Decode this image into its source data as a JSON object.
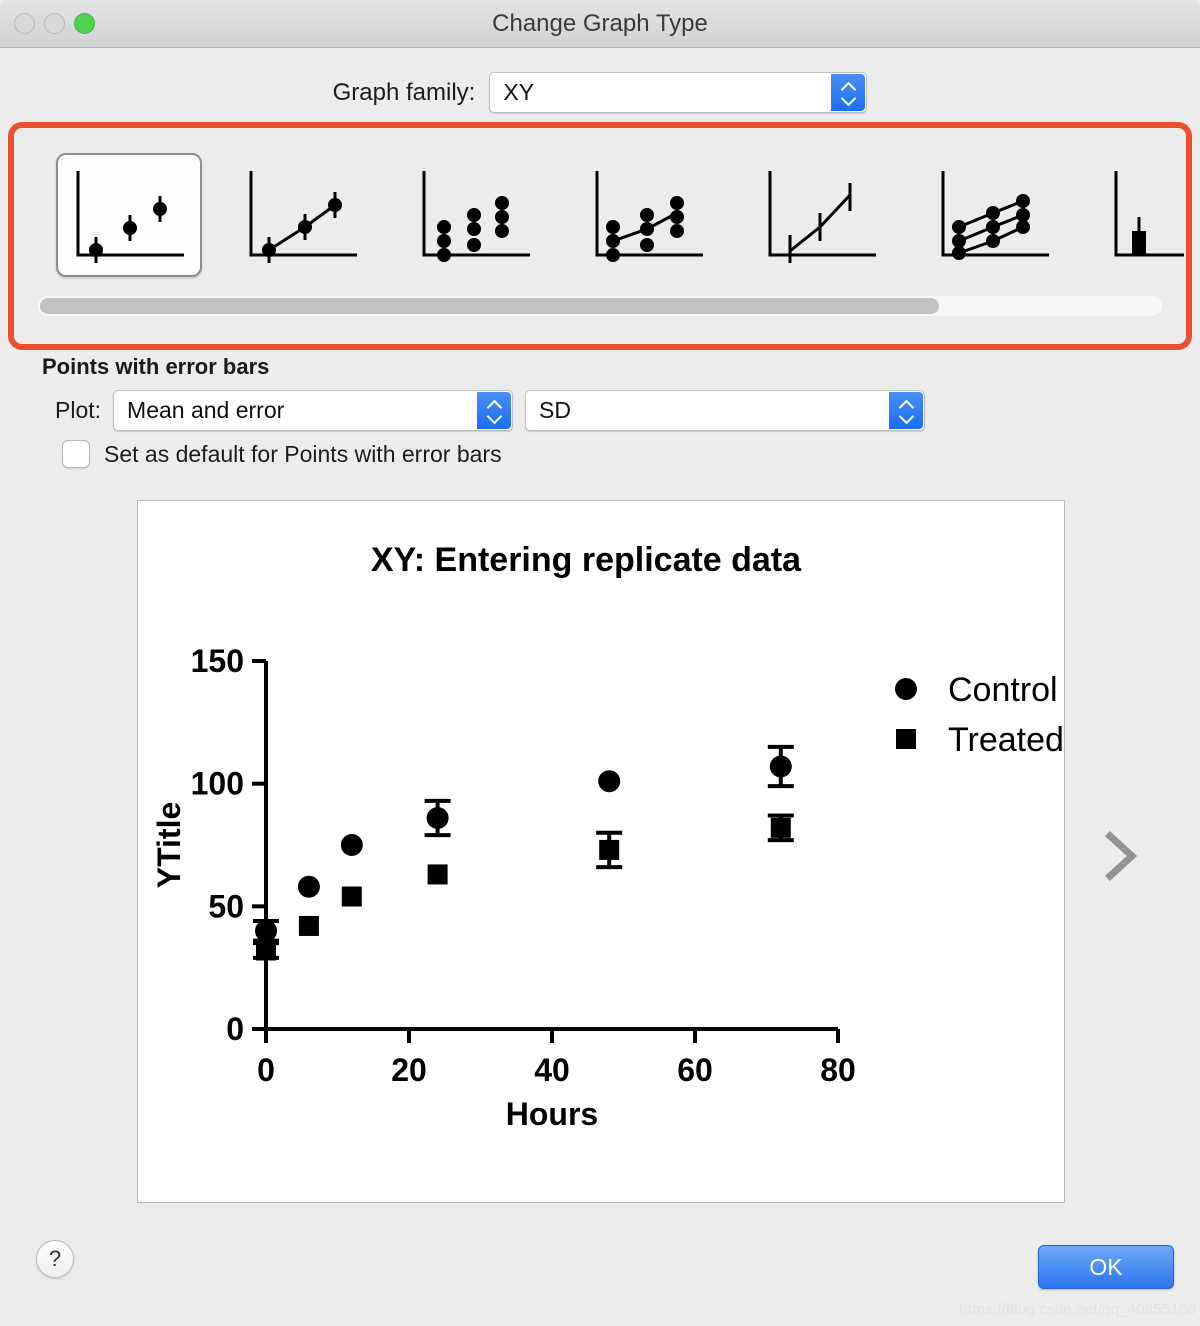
{
  "window": {
    "title": "Change Graph Type",
    "traffic_lights": [
      "close-button",
      "minimize-button",
      "zoom-button"
    ]
  },
  "graph_family": {
    "label": "Graph family:",
    "value": "XY"
  },
  "gallery": {
    "selected_index": 0,
    "scroll_thumb_percent": 80,
    "items": [
      {
        "name": "points-with-error-bars",
        "kind": "points-error"
      },
      {
        "name": "connected-points-with-error-bars",
        "kind": "line-error"
      },
      {
        "name": "scatter-replicates",
        "kind": "replicates"
      },
      {
        "name": "scatter-with-connecting-line",
        "kind": "scatter-line"
      },
      {
        "name": "line-only",
        "kind": "line-plain"
      },
      {
        "name": "multiple-connected-series",
        "kind": "multi-line"
      },
      {
        "name": "bar-with-error",
        "kind": "bar-error"
      }
    ]
  },
  "settings": {
    "section_title": "Points with error bars",
    "plot_label": "Plot:",
    "plot_value": "Mean and error",
    "error_value": "SD",
    "checkbox_checked": false,
    "checkbox_label": "Set as default for Points with error bars"
  },
  "preview": {
    "next_icon": "chevron-right-icon"
  },
  "footer": {
    "help_label": "?",
    "ok_label": "OK",
    "watermark": "https://blog.csdn.net/qq_40855100"
  },
  "chart_data": {
    "type": "scatter",
    "title": "XY: Entering replicate data",
    "xlabel": "Hours",
    "ylabel": "YTitle",
    "xlim": [
      0,
      80
    ],
    "ylim": [
      0,
      150
    ],
    "xticks": [
      0,
      20,
      40,
      60,
      80
    ],
    "yticks": [
      0,
      50,
      100,
      150
    ],
    "grid": false,
    "legend_position": "top-right",
    "x": [
      0,
      6,
      12,
      24,
      48,
      72
    ],
    "series": [
      {
        "name": "Control",
        "marker": "circle",
        "values": [
          40,
          58,
          75,
          86,
          101,
          107
        ],
        "errors": [
          4,
          0,
          0,
          7,
          0,
          8
        ]
      },
      {
        "name": "Treated",
        "marker": "square",
        "values": [
          32,
          42,
          54,
          63,
          73,
          82
        ],
        "errors": [
          3,
          0,
          0,
          0,
          7,
          5
        ]
      }
    ]
  }
}
